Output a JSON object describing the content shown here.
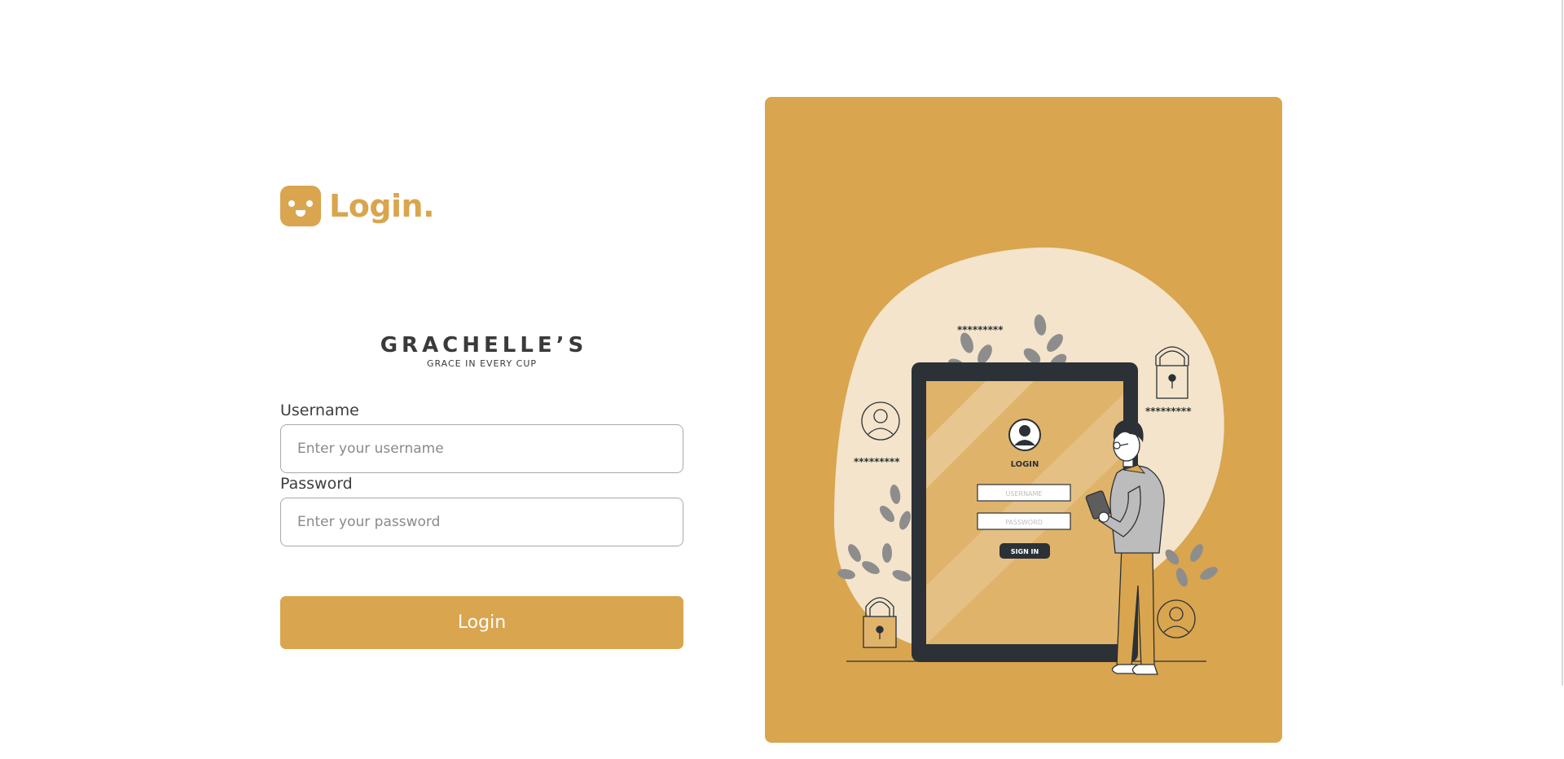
{
  "login_header": {
    "title": "Login."
  },
  "brand": {
    "name": "GRACHELLE’S",
    "tagline": "GRACE IN EVERY CUP"
  },
  "form": {
    "username": {
      "label": "Username",
      "placeholder": "Enter your username",
      "value": ""
    },
    "password": {
      "label": "Password",
      "placeholder": "Enter your password",
      "value": ""
    },
    "submit_label": "Login"
  },
  "illustration": {
    "screen_title": "LOGIN",
    "screen_username": "USERNAME",
    "screen_password": "PASSWORD",
    "screen_signin": "SIGN IN",
    "masked_text": "*********"
  },
  "colors": {
    "accent": "#d9a54f",
    "text": "#3d3d3d",
    "illustration_blob": "#f3e4cb",
    "device_frame": "#2b3136"
  }
}
